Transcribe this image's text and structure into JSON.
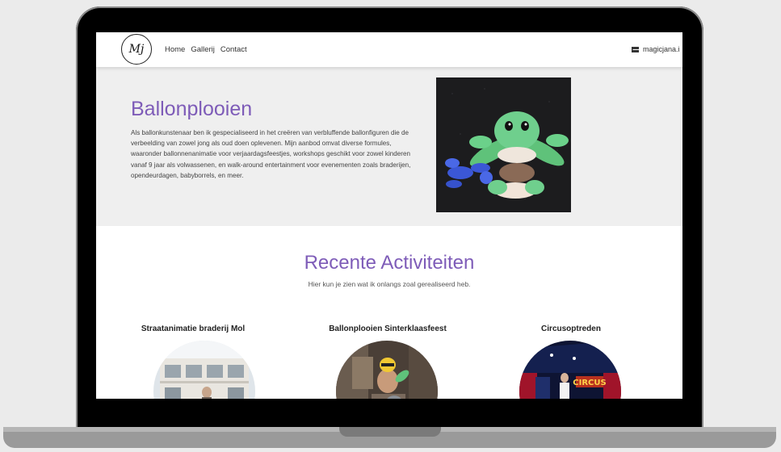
{
  "nav": {
    "logo_text": "Mj",
    "links": [
      "Home",
      "Gallerij",
      "Contact"
    ],
    "email": "magicjana.i"
  },
  "hero": {
    "title": "Ballonplooien",
    "text": "Als ballonkunstenaar ben ik gespecialiseerd in het creëren van verbluffende ballonfiguren die de verbeelding van zowel jong als oud doen oplevenen. Mijn aanbod omvat diverse formules, waaronder ballonnenanimatie voor verjaardagsfeestjes, workshops geschikt voor zowel kinderen vanaf 9 jaar als volwassenen, en walk-around entertainment voor evenementen zoals braderijen, opendeurdagen, babyborrels, en meer."
  },
  "activities": {
    "title": "Recente Activiteiten",
    "subtitle": "Hier kun je zien wat ik onlangs zoal gerealiseerd heb.",
    "cards": [
      {
        "title": "Straatanimatie braderij Mol"
      },
      {
        "title": "Ballonplooien Sinterklaasfeest"
      },
      {
        "title": "Circusoptreden"
      }
    ],
    "circus_sign": "CIRCUS"
  },
  "colors": {
    "accent": "#7e5cb8"
  }
}
